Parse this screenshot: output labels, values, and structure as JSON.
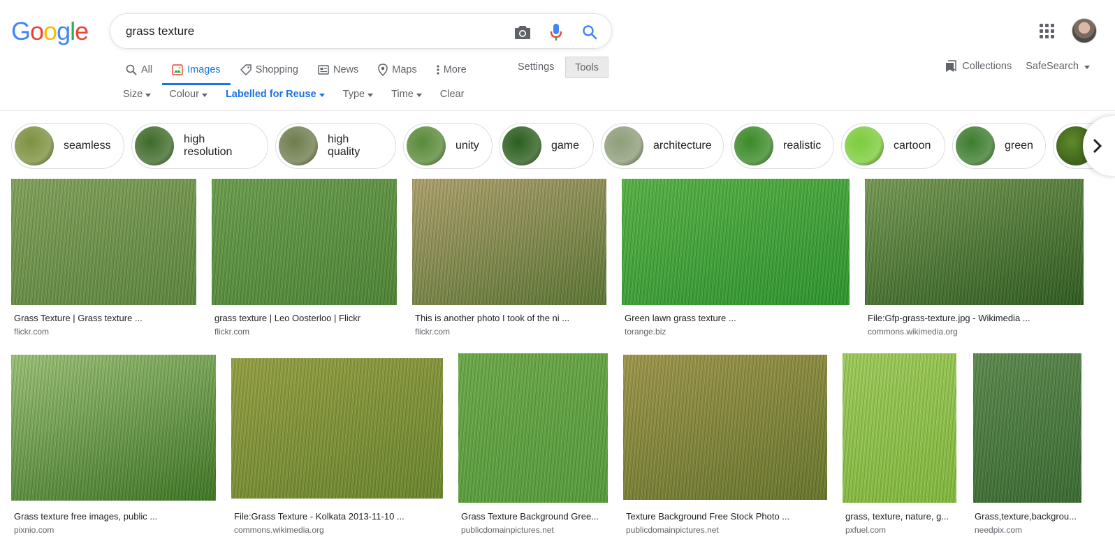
{
  "logo": {
    "text": "Google",
    "letters": [
      {
        "ch": "G",
        "color": "#4285F4"
      },
      {
        "ch": "o",
        "color": "#EA4335"
      },
      {
        "ch": "o",
        "color": "#FBBC05"
      },
      {
        "ch": "g",
        "color": "#4285F4"
      },
      {
        "ch": "l",
        "color": "#34A853"
      },
      {
        "ch": "e",
        "color": "#EA4335"
      }
    ]
  },
  "search": {
    "query": "grass texture"
  },
  "icons": {
    "camera": "camera-icon",
    "mic": "microphone-icon",
    "search": "search-icon",
    "apps": "apps-grid-icon",
    "collections": "bookmark-icon"
  },
  "tabs": [
    {
      "label": "All",
      "icon": "search-icon",
      "active": false
    },
    {
      "label": "Images",
      "icon": "image-icon",
      "active": true
    },
    {
      "label": "Shopping",
      "icon": "tag-icon",
      "active": false
    },
    {
      "label": "News",
      "icon": "newspaper-icon",
      "active": false
    },
    {
      "label": "Maps",
      "icon": "map-pin-icon",
      "active": false
    },
    {
      "label": "More",
      "icon": "more-vertical-icon",
      "active": false
    }
  ],
  "toolbar": {
    "settings": "Settings",
    "tools": "Tools"
  },
  "right_links": {
    "collections": "Collections",
    "safesearch": "SafeSearch"
  },
  "filters": [
    {
      "label": "Size",
      "caret": true,
      "active": false
    },
    {
      "label": "Colour",
      "caret": true,
      "active": false
    },
    {
      "label": "Labelled for Reuse",
      "caret": true,
      "active": true
    },
    {
      "label": "Type",
      "caret": true,
      "active": false
    },
    {
      "label": "Time",
      "caret": true,
      "active": false
    },
    {
      "label": "Clear",
      "caret": false,
      "active": false
    }
  ],
  "chips": [
    {
      "label": "seamless",
      "color": "#7d9140"
    },
    {
      "label": "high resolution",
      "color": "#3f6b2a"
    },
    {
      "label": "high quality",
      "color": "#6f7d4e"
    },
    {
      "label": "unity",
      "color": "#5a8a3a"
    },
    {
      "label": "game",
      "color": "#2c5e1f"
    },
    {
      "label": "architecture",
      "color": "#8e9e7a"
    },
    {
      "label": "realistic",
      "color": "#3b8a28"
    },
    {
      "label": "cartoon",
      "color": "#7ccc3c"
    },
    {
      "label": "green",
      "color": "#3d7d2e"
    }
  ],
  "results": [
    {
      "title": "Grass Texture | Grass texture ...",
      "site": "flickr.com",
      "color": "#5f8a3f",
      "color2": "#87a95e"
    },
    {
      "title": "grass texture | Leo Oosterloo | Flickr",
      "site": "flickr.com",
      "color": "#4f8a36",
      "color2": "#6ea44f"
    },
    {
      "title": "This is another photo I took of the ni ...",
      "site": "flickr.com",
      "color": "#5e7a34",
      "color2": "#b5a770"
    },
    {
      "title": "Green lawn grass texture ...",
      "site": "torange.biz",
      "color": "#2e9b2e",
      "color2": "#5ab947"
    },
    {
      "title": "File:Gfp-grass-texture.jpg - Wikimedia ...",
      "site": "commons.wikimedia.org",
      "color": "#2f5e1f",
      "color2": "#7aa056"
    },
    {
      "title": "Grass texture free images, public ...",
      "site": "pixnio.com",
      "color": "#3f7a23",
      "color2": "#a1c97a"
    },
    {
      "title": "File:Grass Texture - Kolkata 2013-11-10 ...",
      "site": "commons.wikimedia.org",
      "color": "#6e8a2d",
      "color2": "#9aa643"
    },
    {
      "title": "Grass Texture Background Gree...",
      "site": "publicdomainpictures.net",
      "color": "#58a23c",
      "color2": "#6fb04a"
    },
    {
      "title": "Texture Background Free Stock Photo ...",
      "site": "publicdomainpictures.net",
      "color": "#6b7a2b",
      "color2": "#a49c4d"
    },
    {
      "title": "grass, texture, nature, g...",
      "site": "pxfuel.com",
      "color": "#86c03e",
      "color2": "#a4d45c"
    },
    {
      "title": "Grass,texture,backgrou...",
      "site": "needpix.com",
      "color": "#3a6e31",
      "color2": "#5f8f4f"
    }
  ]
}
